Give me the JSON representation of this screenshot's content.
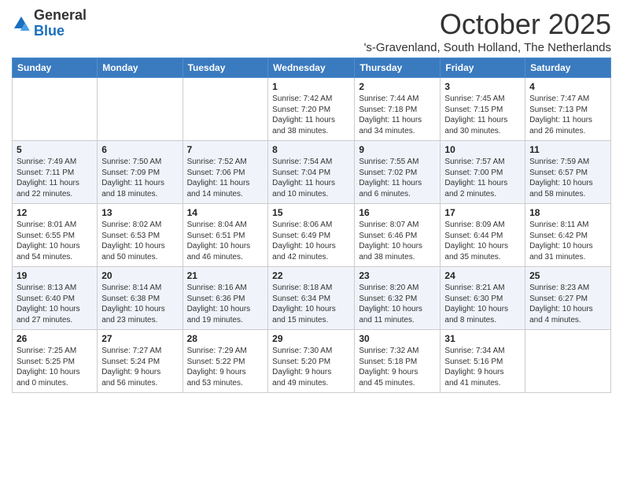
{
  "logo": {
    "general": "General",
    "blue": "Blue"
  },
  "title": "October 2025",
  "subtitle": "'s-Gravenland, South Holland, The Netherlands",
  "days_of_week": [
    "Sunday",
    "Monday",
    "Tuesday",
    "Wednesday",
    "Thursday",
    "Friday",
    "Saturday"
  ],
  "weeks": [
    [
      {
        "day": "",
        "info": ""
      },
      {
        "day": "",
        "info": ""
      },
      {
        "day": "",
        "info": ""
      },
      {
        "day": "1",
        "info": "Sunrise: 7:42 AM\nSunset: 7:20 PM\nDaylight: 11 hours\nand 38 minutes."
      },
      {
        "day": "2",
        "info": "Sunrise: 7:44 AM\nSunset: 7:18 PM\nDaylight: 11 hours\nand 34 minutes."
      },
      {
        "day": "3",
        "info": "Sunrise: 7:45 AM\nSunset: 7:15 PM\nDaylight: 11 hours\nand 30 minutes."
      },
      {
        "day": "4",
        "info": "Sunrise: 7:47 AM\nSunset: 7:13 PM\nDaylight: 11 hours\nand 26 minutes."
      }
    ],
    [
      {
        "day": "5",
        "info": "Sunrise: 7:49 AM\nSunset: 7:11 PM\nDaylight: 11 hours\nand 22 minutes."
      },
      {
        "day": "6",
        "info": "Sunrise: 7:50 AM\nSunset: 7:09 PM\nDaylight: 11 hours\nand 18 minutes."
      },
      {
        "day": "7",
        "info": "Sunrise: 7:52 AM\nSunset: 7:06 PM\nDaylight: 11 hours\nand 14 minutes."
      },
      {
        "day": "8",
        "info": "Sunrise: 7:54 AM\nSunset: 7:04 PM\nDaylight: 11 hours\nand 10 minutes."
      },
      {
        "day": "9",
        "info": "Sunrise: 7:55 AM\nSunset: 7:02 PM\nDaylight: 11 hours\nand 6 minutes."
      },
      {
        "day": "10",
        "info": "Sunrise: 7:57 AM\nSunset: 7:00 PM\nDaylight: 11 hours\nand 2 minutes."
      },
      {
        "day": "11",
        "info": "Sunrise: 7:59 AM\nSunset: 6:57 PM\nDaylight: 10 hours\nand 58 minutes."
      }
    ],
    [
      {
        "day": "12",
        "info": "Sunrise: 8:01 AM\nSunset: 6:55 PM\nDaylight: 10 hours\nand 54 minutes."
      },
      {
        "day": "13",
        "info": "Sunrise: 8:02 AM\nSunset: 6:53 PM\nDaylight: 10 hours\nand 50 minutes."
      },
      {
        "day": "14",
        "info": "Sunrise: 8:04 AM\nSunset: 6:51 PM\nDaylight: 10 hours\nand 46 minutes."
      },
      {
        "day": "15",
        "info": "Sunrise: 8:06 AM\nSunset: 6:49 PM\nDaylight: 10 hours\nand 42 minutes."
      },
      {
        "day": "16",
        "info": "Sunrise: 8:07 AM\nSunset: 6:46 PM\nDaylight: 10 hours\nand 38 minutes."
      },
      {
        "day": "17",
        "info": "Sunrise: 8:09 AM\nSunset: 6:44 PM\nDaylight: 10 hours\nand 35 minutes."
      },
      {
        "day": "18",
        "info": "Sunrise: 8:11 AM\nSunset: 6:42 PM\nDaylight: 10 hours\nand 31 minutes."
      }
    ],
    [
      {
        "day": "19",
        "info": "Sunrise: 8:13 AM\nSunset: 6:40 PM\nDaylight: 10 hours\nand 27 minutes."
      },
      {
        "day": "20",
        "info": "Sunrise: 8:14 AM\nSunset: 6:38 PM\nDaylight: 10 hours\nand 23 minutes."
      },
      {
        "day": "21",
        "info": "Sunrise: 8:16 AM\nSunset: 6:36 PM\nDaylight: 10 hours\nand 19 minutes."
      },
      {
        "day": "22",
        "info": "Sunrise: 8:18 AM\nSunset: 6:34 PM\nDaylight: 10 hours\nand 15 minutes."
      },
      {
        "day": "23",
        "info": "Sunrise: 8:20 AM\nSunset: 6:32 PM\nDaylight: 10 hours\nand 11 minutes."
      },
      {
        "day": "24",
        "info": "Sunrise: 8:21 AM\nSunset: 6:30 PM\nDaylight: 10 hours\nand 8 minutes."
      },
      {
        "day": "25",
        "info": "Sunrise: 8:23 AM\nSunset: 6:27 PM\nDaylight: 10 hours\nand 4 minutes."
      }
    ],
    [
      {
        "day": "26",
        "info": "Sunrise: 7:25 AM\nSunset: 5:25 PM\nDaylight: 10 hours\nand 0 minutes."
      },
      {
        "day": "27",
        "info": "Sunrise: 7:27 AM\nSunset: 5:24 PM\nDaylight: 9 hours\nand 56 minutes."
      },
      {
        "day": "28",
        "info": "Sunrise: 7:29 AM\nSunset: 5:22 PM\nDaylight: 9 hours\nand 53 minutes."
      },
      {
        "day": "29",
        "info": "Sunrise: 7:30 AM\nSunset: 5:20 PM\nDaylight: 9 hours\nand 49 minutes."
      },
      {
        "day": "30",
        "info": "Sunrise: 7:32 AM\nSunset: 5:18 PM\nDaylight: 9 hours\nand 45 minutes."
      },
      {
        "day": "31",
        "info": "Sunrise: 7:34 AM\nSunset: 5:16 PM\nDaylight: 9 hours\nand 41 minutes."
      },
      {
        "day": "",
        "info": ""
      }
    ]
  ]
}
